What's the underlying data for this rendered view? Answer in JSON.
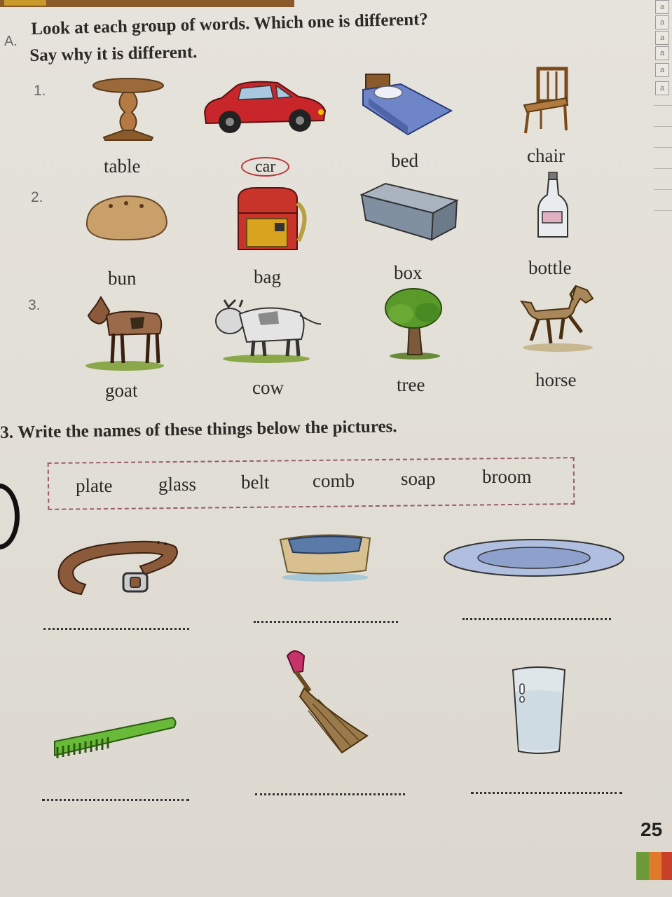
{
  "section_a": {
    "letter": "A.",
    "line1": "Look at each group of words. Which one is different?",
    "line2": "Say why it is different."
  },
  "groups": [
    {
      "number": "1.",
      "words": [
        "table",
        "car",
        "bed",
        "chair"
      ],
      "circled": "car"
    },
    {
      "number": "2.",
      "words": [
        "bun",
        "bag",
        "box",
        "bottle"
      ]
    },
    {
      "number": "3.",
      "words": [
        "goat",
        "cow",
        "tree",
        "horse"
      ]
    }
  ],
  "section_b": {
    "letter": "3.",
    "title": "Write the names of these things below the pictures."
  },
  "word_bank": [
    "plate",
    "glass",
    "belt",
    "comb",
    "soap",
    "broom"
  ],
  "margin_tabs": [
    "a",
    "a",
    "a",
    "a",
    "a",
    "a"
  ],
  "page_number": "25",
  "colors": {
    "stripe_green": "#6f9a3a",
    "stripe_orange": "#e07a2a",
    "stripe_red": "#c8402a",
    "circle": "#b33333"
  }
}
